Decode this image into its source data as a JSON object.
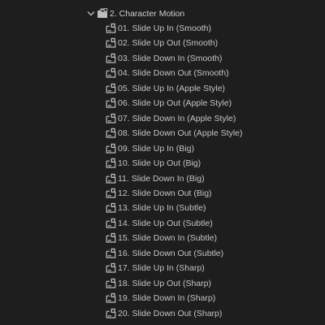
{
  "panel": {
    "folder": {
      "label": "2. Character Motion",
      "expanded": true,
      "icon": "folder-bin-icon"
    },
    "items": [
      {
        "label": "01. Slide Up In (Smooth)",
        "icon": "preset-file-icon"
      },
      {
        "label": "02. Slide Up Out (Smooth)",
        "icon": "preset-file-icon"
      },
      {
        "label": "03. Slide Down In (Smooth)",
        "icon": "preset-file-icon"
      },
      {
        "label": "04. Slide Down Out (Smooth)",
        "icon": "preset-file-icon"
      },
      {
        "label": "05. Slide Up In (Apple Style)",
        "icon": "preset-file-icon"
      },
      {
        "label": "06. Slide Up Out (Apple Style)",
        "icon": "preset-file-icon"
      },
      {
        "label": "07. Slide Down In (Apple Style)",
        "icon": "preset-file-icon"
      },
      {
        "label": "08. Slide Down Out (Apple Style)",
        "icon": "preset-file-icon"
      },
      {
        "label": "09. Slide Up In (Big)",
        "icon": "preset-file-icon"
      },
      {
        "label": "10. Slide Up Out (Big)",
        "icon": "preset-file-icon"
      },
      {
        "label": "11. Slide Down In (Big)",
        "icon": "preset-file-icon"
      },
      {
        "label": "12. Slide Down Out (Big)",
        "icon": "preset-file-icon"
      },
      {
        "label": "13. Slide Up In (Subtle)",
        "icon": "preset-file-icon"
      },
      {
        "label": "14. Slide Up Out (Subtle)",
        "icon": "preset-file-icon"
      },
      {
        "label": "15. Slide Down In (Subtle)",
        "icon": "preset-file-icon"
      },
      {
        "label": "16. Slide Down Out (Subtle)",
        "icon": "preset-file-icon"
      },
      {
        "label": "17. Slide Up In (Sharp)",
        "icon": "preset-file-icon"
      },
      {
        "label": "18. Slide Up Out (Sharp)",
        "icon": "preset-file-icon"
      },
      {
        "label": "19. Slide Down In (Sharp)",
        "icon": "preset-file-icon"
      },
      {
        "label": "20. Slide Down Out (Sharp)",
        "icon": "preset-file-icon"
      }
    ],
    "colors": {
      "background": "#1e1e1e",
      "text": "#c4c4c4",
      "icon": "#bdbdbd"
    }
  }
}
